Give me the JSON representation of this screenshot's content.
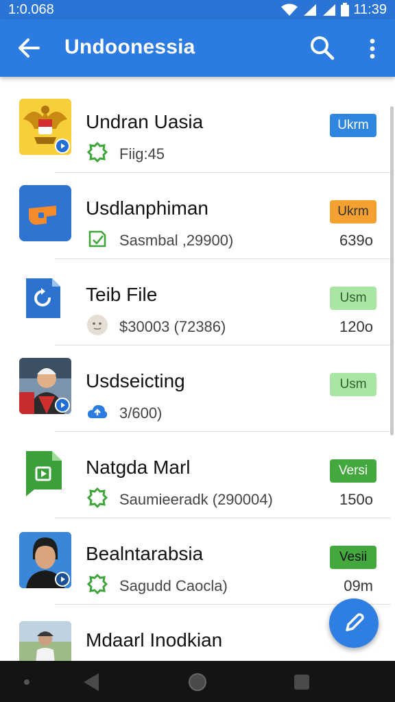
{
  "status_bar": {
    "time_left": "1:0.068",
    "time_right": "11:39"
  },
  "app_bar": {
    "title": "Undoonessia"
  },
  "items": [
    {
      "title": "Undran Uasia",
      "subtitle": "Fiig:45",
      "badge": "Ukrm",
      "badge_bg": "#2e86de",
      "badge_fg": "#ffffff",
      "meta": ""
    },
    {
      "title": "Usdlanphiman",
      "subtitle": "Sasmbal ,29900)",
      "badge": "Ukrm",
      "badge_bg": "#f5a132",
      "badge_fg": "#333333",
      "meta": "639o"
    },
    {
      "title": "Teib File",
      "subtitle": "$30003 (72386)",
      "badge": "Usm",
      "badge_bg": "#a9e6a4",
      "badge_fg": "#2f5f2c",
      "meta": "120o"
    },
    {
      "title": "Usdseicting",
      "subtitle": "3/600)",
      "badge": "Usm",
      "badge_bg": "#a9e6a4",
      "badge_fg": "#2f5f2c",
      "meta": ""
    },
    {
      "title": "Natgda Marl",
      "subtitle": "Saumieeradk (290004)",
      "badge": "Versi",
      "badge_bg": "#43a83e",
      "badge_fg": "#ffffff",
      "meta": "150o"
    },
    {
      "title": "Bealntarabsia",
      "subtitle": "Sagudd Caocla)",
      "badge": "Vesii",
      "badge_bg": "#43a83e",
      "badge_fg": "#111111",
      "meta": "09m"
    },
    {
      "title": "Mdaarl Inodkian",
      "subtitle": "",
      "badge": "",
      "badge_bg": "",
      "badge_fg": "",
      "meta": ""
    }
  ],
  "colors": {
    "app_bar": "#2c7be0",
    "status_bar": "#2a74d6",
    "fab": "#2f7fe2",
    "nav_bar": "#141414"
  },
  "icons": {
    "back": "arrow-left-icon",
    "search": "search-icon",
    "more": "more-vertical-icon",
    "fab": "edit-icon",
    "nav_back": "triangle-back-icon",
    "nav_home": "circle-home-icon",
    "nav_recents": "square-recents-icon"
  }
}
